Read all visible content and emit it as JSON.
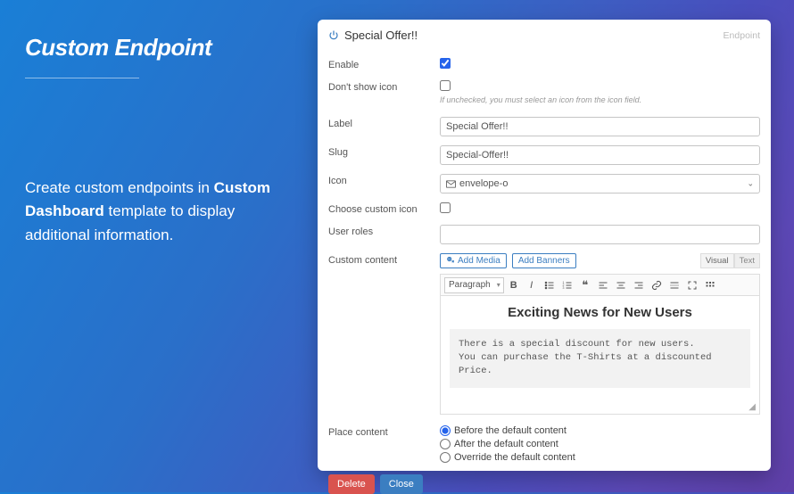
{
  "left": {
    "title": "Custom Endpoint",
    "body_pre": "Create custom endpoints in ",
    "body_bold": "Custom Dashboard",
    "body_post": " template to display additional information."
  },
  "panel": {
    "title": "Special Offer!!",
    "tag": "Endpoint",
    "labels": {
      "enable": "Enable",
      "dont_show_icon": "Don't show icon",
      "dont_show_hint": "If unchecked, you must select an icon from the icon field.",
      "label": "Label",
      "slug": "Slug",
      "icon": "Icon",
      "choose_custom_icon": "Choose custom icon",
      "user_roles": "User roles",
      "custom_content": "Custom content",
      "place_content": "Place content"
    },
    "values": {
      "enable_checked": true,
      "dont_show_icon_checked": false,
      "choose_custom_icon_checked": false,
      "label": "Special Offer!!",
      "slug": "Special-Offer!!",
      "icon": "envelope-o",
      "user_roles": ""
    },
    "editor": {
      "add_media": "Add Media",
      "add_banners": "Add Banners",
      "tab_visual": "Visual",
      "tab_text": "Text",
      "para_label": "Paragraph",
      "heading": "Exciting News for New Users",
      "body_line1": "There is a special discount for new users.",
      "body_line2": "You can purchase the T-Shirts at a discounted Price."
    },
    "place_options": {
      "before": "Before the default content",
      "after": "After the default content",
      "override": "Override the default content",
      "selected": "before"
    },
    "buttons": {
      "delete": "Delete",
      "close": "Close"
    }
  }
}
